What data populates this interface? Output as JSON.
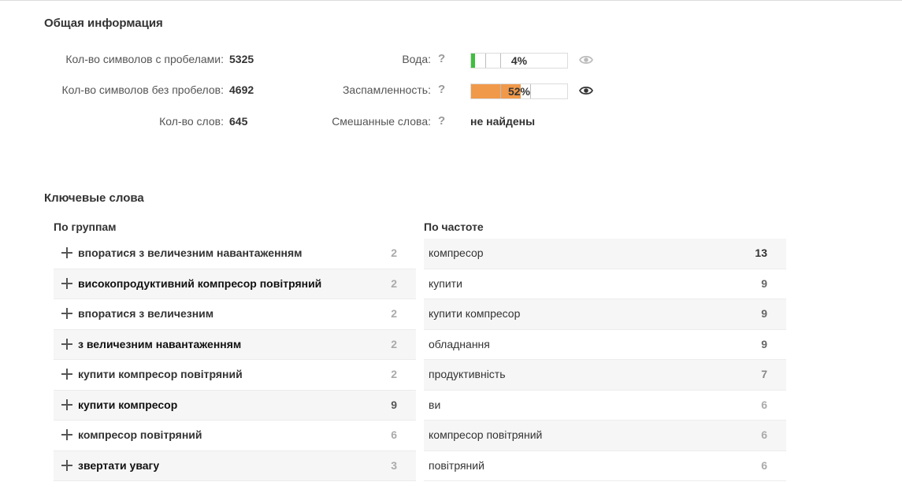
{
  "general": {
    "title": "Общая информация",
    "chars_with_spaces_label": "Кол-во символов с пробелами:",
    "chars_with_spaces": "5325",
    "chars_no_spaces_label": "Кол-во символов без пробелов:",
    "chars_no_spaces": "4692",
    "words_label": "Кол-во слов:",
    "words": "645",
    "water_label": "Вода:",
    "water_pct": "4%",
    "water_value": 4,
    "spam_label": "Заспамленность:",
    "spam_pct": "52%",
    "spam_value": 52,
    "mixed_label": "Смешанные слова:",
    "mixed_value": "не найдены",
    "help_glyph": "?",
    "colors": {
      "water": "#3fbf3f",
      "spam": "#f0994a"
    },
    "icons": {
      "help": "question-icon",
      "eye": "eye-icon"
    }
  },
  "keywords": {
    "title": "Ключевые слова",
    "groups_title": "По группам",
    "freq_title": "По частоте",
    "groups": [
      {
        "phrase": "впоратися з величезним навантаженням",
        "count": "2"
      },
      {
        "phrase": "високопродуктивний компресор повітряний",
        "count": "2"
      },
      {
        "phrase": "впоратися з величезним",
        "count": "2"
      },
      {
        "phrase": "з величезним навантаженням",
        "count": "2"
      },
      {
        "phrase": "купити компресор повітряний",
        "count": "2"
      },
      {
        "phrase": "купити компресор",
        "count": "9"
      },
      {
        "phrase": "компресор повітряний",
        "count": "6"
      },
      {
        "phrase": "звертати увагу",
        "count": "3"
      }
    ],
    "frequency": [
      {
        "word": "компресор",
        "count": "13"
      },
      {
        "word": "купити",
        "count": "9"
      },
      {
        "word": "купити компресор",
        "count": "9"
      },
      {
        "word": "обладнання",
        "count": "9"
      },
      {
        "word": "продуктивність",
        "count": "7"
      },
      {
        "word": "ви",
        "count": "6"
      },
      {
        "word": "компресор повітряний",
        "count": "6"
      },
      {
        "word": "повітряний",
        "count": "6"
      }
    ]
  }
}
